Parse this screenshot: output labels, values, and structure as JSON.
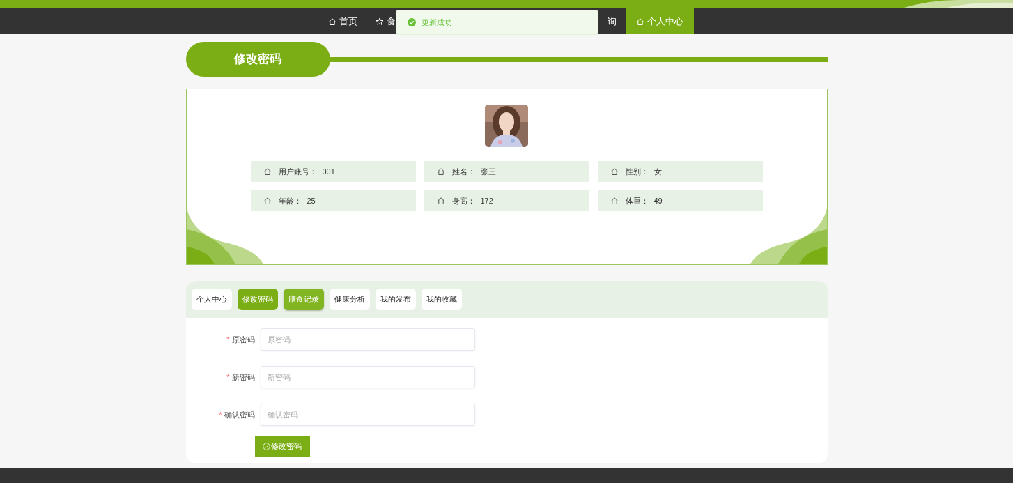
{
  "nav": {
    "items": [
      {
        "kind": "home",
        "label": "首页",
        "selected": false
      },
      {
        "kind": "star",
        "label": "食",
        "selected": false
      },
      {
        "kind": "none",
        "label": "询",
        "selected": false
      },
      {
        "kind": "home",
        "label": "个人中心",
        "selected": true
      }
    ]
  },
  "toast": {
    "message": "更新成功"
  },
  "page_title": "修改密码",
  "profile": {
    "fields": [
      {
        "label": "用户账号：",
        "value": "001"
      },
      {
        "label": "姓名：",
        "value": "张三"
      },
      {
        "label": "性别：",
        "value": "女"
      },
      {
        "label": "年龄：",
        "value": "25"
      },
      {
        "label": "身高：",
        "value": "172"
      },
      {
        "label": "体重：",
        "value": "49"
      }
    ]
  },
  "tabs": [
    {
      "label": "个人中心",
      "selected": false,
      "hovered": false
    },
    {
      "label": "修改密码",
      "selected": true,
      "hovered": false
    },
    {
      "label": "膳食记录",
      "selected": false,
      "hovered": true
    },
    {
      "label": "健康分析",
      "selected": false,
      "hovered": false
    },
    {
      "label": "我的发布",
      "selected": false,
      "hovered": false
    },
    {
      "label": "我的收藏",
      "selected": false,
      "hovered": false
    }
  ],
  "form": {
    "fields": [
      {
        "label": "原密码",
        "required_mark": "*",
        "placeholder": "原密码"
      },
      {
        "label": "新密码",
        "required_mark": "*",
        "placeholder": "新密码"
      },
      {
        "label": "确认密码",
        "required_mark": "*",
        "placeholder": "确认密码"
      }
    ],
    "submit": "修改密码"
  }
}
